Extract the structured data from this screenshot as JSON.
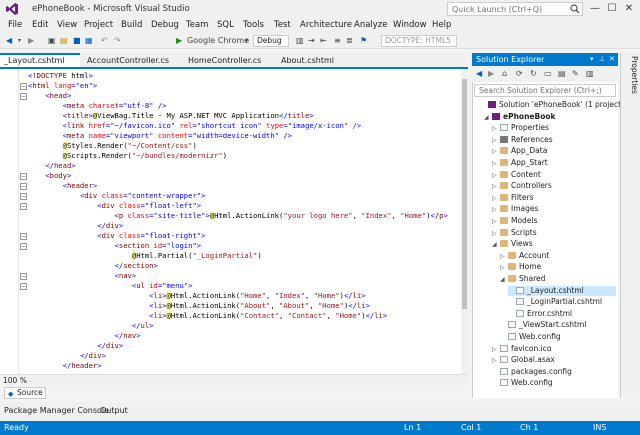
{
  "window": {
    "title": "ePhoneBook - Microsoft Visual Studio",
    "quick_launch_placeholder": "Quick Launch (Ctrl+Q)",
    "minimize": "—",
    "maximize": "☐",
    "close": "✕"
  },
  "menu": [
    "File",
    "Edit",
    "View",
    "Project",
    "Build",
    "Debug",
    "Team",
    "SQL",
    "Tools",
    "Test",
    "Architecture",
    "Analyze",
    "Window",
    "Help"
  ],
  "toolbar": {
    "run_target": "Google Chrome",
    "config": "Debug",
    "doctype": "DOCTYPE: HTML5"
  },
  "tabs": [
    {
      "label": "_Layout.cshtml",
      "close": "✕",
      "active": true
    },
    {
      "label": "AccountController.cs"
    },
    {
      "label": "HomeController.cs"
    },
    {
      "label": "About.cshtml"
    }
  ],
  "code": [
    "<!DOCTYPE html>",
    "<html lang=\"en\">",
    "    <head>",
    "        <meta charset=\"utf-8\" />",
    "        <title>@ViewBag.Title - My ASP.NET MVC Application</title>",
    "        <link href=\"~/favicon.ico\" rel=\"shortcut icon\" type=\"image/x-icon\" />",
    "        <meta name=\"viewport\" content=\"width=device-width\" />",
    "        @Styles.Render(\"~/Content/css\")",
    "        @Scripts.Render(\"~/bundles/modernizr\")",
    "    </head>",
    "    <body>",
    "        <header>",
    "            <div class=\"content-wrapper\">",
    "                <div class=\"float-left\">",
    "                    <p class=\"site-title\">@Html.ActionLink(\"your logo here\", \"Index\", \"Home\")</p>",
    "                </div>",
    "                <div class=\"float-right\">",
    "                    <section id=\"login\">",
    "                        @Html.Partial(\"_LoginPartial\")",
    "                    </section>",
    "                    <nav>",
    "                        <ul id=\"menu\">",
    "                            <li>@Html.ActionLink(\"Home\", \"Index\", \"Home\")</li>",
    "                            <li>@Html.ActionLink(\"About\", \"About\", \"Home\")</li>",
    "                            <li>@Html.ActionLink(\"Contact\", \"Contact\", \"Home\")</li>",
    "                        </ul>",
    "                    </nav>",
    "                </div>",
    "            </div>",
    "        </header>"
  ],
  "editor": {
    "zoom": "100 %",
    "source_tab": "Source"
  },
  "solution_explorer": {
    "title": "Solution Explorer",
    "search_placeholder": "Search Solution Explorer (Ctrl+;)",
    "items": [
      {
        "label": "Solution 'ePhoneBook' (1 project)",
        "icon": "sol"
      },
      {
        "label": "ePhoneBook",
        "icon": "cs-file",
        "bold": true
      },
      {
        "label": "Properties",
        "icon": "file"
      },
      {
        "label": "References",
        "icon": "ref"
      },
      {
        "label": "App_Data",
        "icon": "folder"
      },
      {
        "label": "App_Start",
        "icon": "folder"
      },
      {
        "label": "Content",
        "icon": "folder"
      },
      {
        "label": "Controllers",
        "icon": "folder"
      },
      {
        "label": "Filters",
        "icon": "folder"
      },
      {
        "label": "Images",
        "icon": "folder"
      },
      {
        "label": "Models",
        "icon": "folder"
      },
      {
        "label": "Scripts",
        "icon": "folder"
      },
      {
        "label": "Views",
        "icon": "folder"
      },
      {
        "label": "Account",
        "icon": "folder"
      },
      {
        "label": "Home",
        "icon": "folder"
      },
      {
        "label": "Shared",
        "icon": "folder"
      },
      {
        "label": "_Layout.cshtml",
        "icon": "file",
        "selected": true
      },
      {
        "label": "_LoginPartial.cshtml",
        "icon": "file"
      },
      {
        "label": "Error.cshtml",
        "icon": "file"
      },
      {
        "label": "_ViewStart.cshtml",
        "icon": "file"
      },
      {
        "label": "Web.config",
        "icon": "file"
      },
      {
        "label": "favicon.ico",
        "icon": "file"
      },
      {
        "label": "Global.asax",
        "icon": "file"
      },
      {
        "label": "packages.config",
        "icon": "file"
      },
      {
        "label": "Web.config",
        "icon": "file"
      }
    ]
  },
  "properties_label": "Properties",
  "bottom_tabs": [
    "Package Manager Console",
    "Output"
  ],
  "status": {
    "ready": "Ready",
    "line": "Ln 1",
    "col": "Col 1",
    "ch": "Ch 1",
    "ins": "INS"
  }
}
